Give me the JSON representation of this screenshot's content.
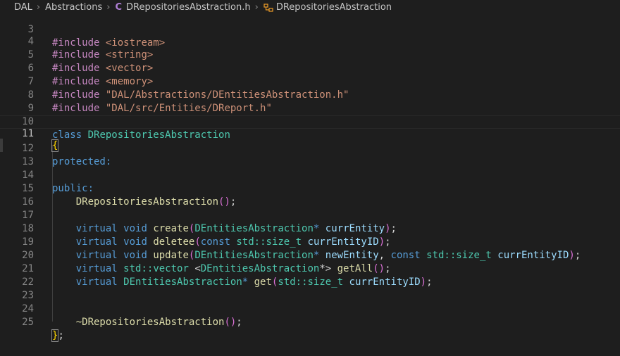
{
  "breadcrumb": {
    "items": [
      "DAL",
      "Abstractions",
      "DRepositoriesAbstraction.h",
      "DRepositoriesAbstraction"
    ],
    "file_icon": "C",
    "class_icon": "class-symbol-icon"
  },
  "editor": {
    "current_line": 11,
    "lines": [
      {
        "n": "3"
      },
      {
        "n": "4"
      },
      {
        "n": "5"
      },
      {
        "n": "6"
      },
      {
        "n": "7"
      },
      {
        "n": "8"
      },
      {
        "n": "9"
      },
      {
        "n": "10"
      },
      {
        "n": "11"
      },
      {
        "n": "12"
      },
      {
        "n": "13"
      },
      {
        "n": "14"
      },
      {
        "n": "15"
      },
      {
        "n": "16"
      },
      {
        "n": "17"
      },
      {
        "n": "18"
      },
      {
        "n": "19"
      },
      {
        "n": "20"
      },
      {
        "n": "21"
      },
      {
        "n": "22"
      },
      {
        "n": "23"
      },
      {
        "n": "24"
      },
      {
        "n": "25"
      }
    ],
    "code": {
      "l3_pre": "#include",
      "l3_str": "<iostream>",
      "l4_pre": "#include",
      "l4_str": "<string>",
      "l5_pre": "#include",
      "l5_str": "<vector>",
      "l6_pre": "#include",
      "l6_str": "<memory>",
      "l7_pre": "#include",
      "l7_str": "\"DAL/Abstractions/DEntitiesAbstraction.h\"",
      "l8_pre": "#include",
      "l8_str": "\"DAL/src/Entities/DReport.h\"",
      "l10_kw": "class",
      "l10_type": "DRepositoriesAbstraction",
      "l11_brace": "{",
      "l12_kw": "protected:",
      "l14_kw": "public:",
      "l15_fn": "DRepositoriesAbstraction",
      "l17_kw1": "virtual",
      "l17_kw2": "void",
      "l17_fn": "create",
      "l17_type": "DEntitiesAbstraction",
      "l17_var": "currEntity",
      "l18_kw1": "virtual",
      "l18_kw2": "void",
      "l18_fn": "deletee",
      "l18_kw3": "const",
      "l18_type": "std::size_t",
      "l18_var": "currEntityID",
      "l19_kw1": "virtual",
      "l19_kw2": "void",
      "l19_fn": "update",
      "l19_type1": "DEntitiesAbstraction",
      "l19_var1": "newEntity",
      "l19_kw3": "const",
      "l19_type2": "std::size_t",
      "l19_var2": "currEntityID",
      "l20_kw1": "virtual",
      "l20_type1": "std::vector",
      "l20_type2": "DEntitiesAbstraction",
      "l20_fn": "getAll",
      "l21_kw1": "virtual",
      "l21_type1": "DEntitiesAbstraction",
      "l21_fn": "get",
      "l21_type2": "std::size_t",
      "l21_var": "currEntityID",
      "l24_fn": "~DRepositoriesAbstraction",
      "l25_brace": "}"
    }
  },
  "colors": {
    "background": "#1e1e1e",
    "preprocessor": "#c586c0",
    "string": "#ce9178",
    "keyword": "#569cd6",
    "type": "#4ec9b0",
    "function": "#dcdcaa",
    "variable": "#9cdcfe"
  }
}
